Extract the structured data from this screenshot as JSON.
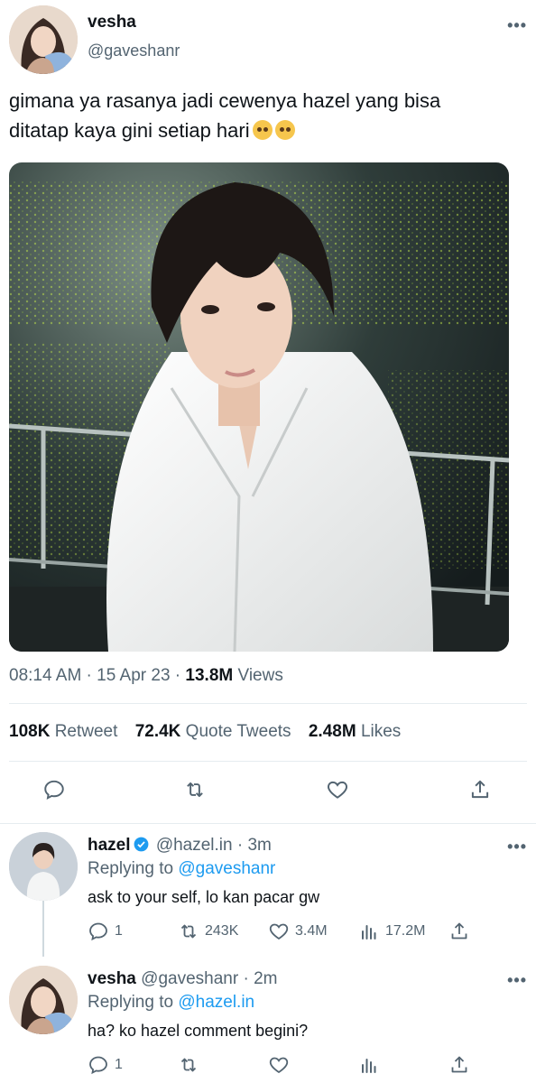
{
  "tweet": {
    "author_name": "vesha",
    "author_handle": "@gaveshanr",
    "text_line1": "gimana ya rasanya jadi cewenya hazel yang bisa",
    "text_line2": "ditatap kaya gini setiap hari",
    "emoji_icons": [
      "pleading-face-emoji",
      "pleading-face-emoji"
    ],
    "time": "08:14 AM",
    "date": "15 Apr 23",
    "views_count": "13.8M",
    "views_label": "Views",
    "retweets_count": "108K",
    "retweets_label": "Retweet",
    "quotes_count": "72.4K",
    "quotes_label": "Quote Tweets",
    "likes_count": "2.48M",
    "likes_label": "Likes",
    "more_label": "•••"
  },
  "replies": [
    {
      "name": "hazel",
      "verified": true,
      "handle": "@hazel.in",
      "age": "3m",
      "replying_prefix": "Replying to",
      "replying_to": "@gaveshanr",
      "text": "ask to your self, lo kan pacar gw",
      "reply_count": "1",
      "retweet_count": "243K",
      "like_count": "3.4M",
      "view_count": "17.2M",
      "more_label": "•••"
    },
    {
      "name": "vesha",
      "verified": false,
      "handle": "@gaveshanr",
      "age": "2m",
      "replying_prefix": "Replying to",
      "replying_to": "@hazel.in",
      "text": "ha? ko hazel comment begini?",
      "reply_count": "1",
      "retweet_count": "",
      "like_count": "",
      "view_count": "",
      "more_label": "•••"
    }
  ],
  "colors": {
    "link": "#1d9bf0",
    "secondary_text": "#536471",
    "divider": "#e6ecf0"
  }
}
